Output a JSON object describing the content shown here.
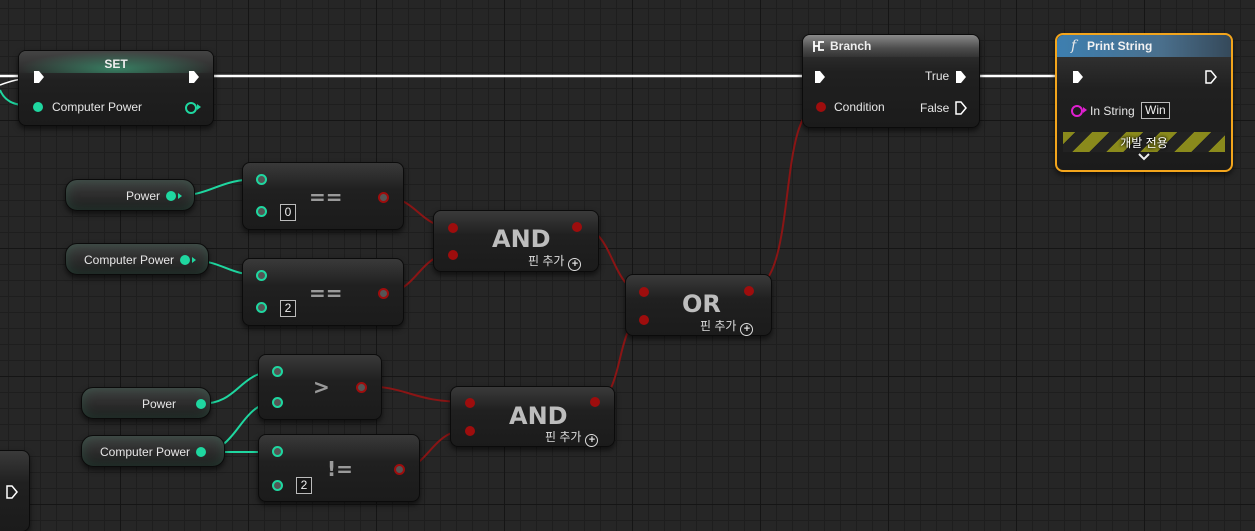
{
  "colors": {
    "float_pin": "#1fd7a0",
    "bool_pin": "#9e0d0d",
    "bool_wire": "#8a1515",
    "exec_wire": "#ffffff",
    "string_pin": "#e01fd0",
    "selection": "#f3a51c"
  },
  "set_node": {
    "title": "SET",
    "var_label": "Computer Power"
  },
  "branch_node": {
    "title": "Branch",
    "icon": "branch-icon",
    "true_label": "True",
    "false_label": "False",
    "condition_label": "Condition"
  },
  "print_node": {
    "title": "Print String",
    "icon": "function-icon",
    "in_string_label": "In String",
    "in_string_value": "Win",
    "dev_only": "개발 전용",
    "expand_icon": "chevron-down-icon"
  },
  "vars": {
    "power_1": "Power",
    "computer_power_1": "Computer Power",
    "power_2": "Power",
    "computer_power_2": "Computer Power"
  },
  "compare_nodes": {
    "eq1": {
      "op": "==",
      "value": "0"
    },
    "eq2": {
      "op": "==",
      "value": "2"
    },
    "gt": {
      "op": ">"
    },
    "ne": {
      "op": "!=",
      "value": "2"
    }
  },
  "logic_nodes": {
    "and1": {
      "title": "AND",
      "add_pin": "핀 추가"
    },
    "or1": {
      "title": "OR",
      "add_pin": "핀 추가"
    },
    "and2": {
      "title": "AND",
      "add_pin": "핀 추가"
    }
  }
}
